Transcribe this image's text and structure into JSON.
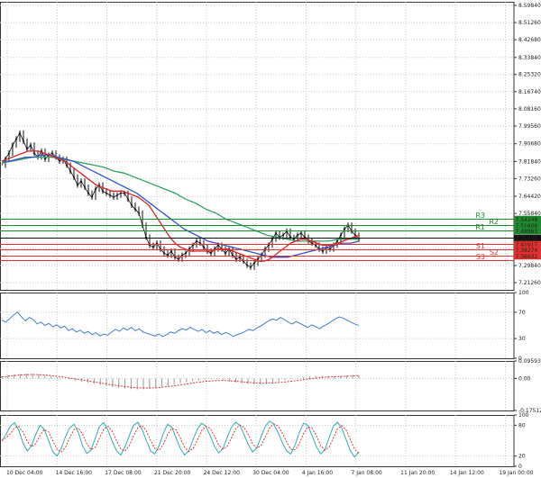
{
  "chart_data": {
    "type": "line",
    "price": {
      "yticks": [
        "8.59840",
        "8.51260",
        "8.42680",
        "8.33840",
        "8.25320",
        "8.16740",
        "8.08160",
        "7.99560",
        "7.90680",
        "7.81840",
        "7.73260",
        "7.64420",
        "7.55840",
        "7.47260",
        "7.38420",
        "7.29840",
        "7.21260"
      ],
      "ylim": [
        7.2126,
        8.5984
      ],
      "close": [
        7.8,
        7.83,
        7.86,
        7.9,
        7.93,
        7.96,
        7.92,
        7.88,
        7.9,
        7.86,
        7.84,
        7.87,
        7.83,
        7.85,
        7.86,
        7.84,
        7.82,
        7.83,
        7.8,
        7.77,
        7.74,
        7.7,
        7.72,
        7.69,
        7.66,
        7.64,
        7.68,
        7.7,
        7.67,
        7.66,
        7.65,
        7.64,
        7.65,
        7.66,
        7.66,
        7.63,
        7.6,
        7.58,
        7.56,
        7.5,
        7.44,
        7.4,
        7.39,
        7.41,
        7.38,
        7.36,
        7.35,
        7.37,
        7.34,
        7.33,
        7.35,
        7.36,
        7.38,
        7.4,
        7.42,
        7.41,
        7.39,
        7.37,
        7.36,
        7.38,
        7.4,
        7.38,
        7.36,
        7.38,
        7.35,
        7.33,
        7.34,
        7.32,
        7.3,
        7.29,
        7.31,
        7.33,
        7.35,
        7.38,
        7.4,
        7.43,
        7.46,
        7.44,
        7.45,
        7.47,
        7.44,
        7.43,
        7.45,
        7.46,
        7.44,
        7.42,
        7.41,
        7.4,
        7.38,
        7.37,
        7.39,
        7.38,
        7.4,
        7.42,
        7.45,
        7.48,
        7.5,
        7.47,
        7.45,
        7.43
      ],
      "ma_fast": [
        7.82,
        7.83,
        7.84,
        7.85,
        7.86,
        7.87,
        7.87,
        7.87,
        7.86,
        7.85,
        7.84,
        7.83,
        7.82,
        7.8,
        7.78,
        7.76,
        7.74,
        7.72,
        7.7,
        7.69,
        7.68,
        7.67,
        7.67,
        7.67,
        7.66,
        7.65,
        7.64,
        7.62,
        7.6,
        7.56,
        7.52,
        7.48,
        7.44,
        7.41,
        7.39,
        7.38,
        7.37,
        7.37,
        7.37,
        7.37,
        7.37,
        7.38,
        7.38,
        7.38,
        7.37,
        7.36,
        7.35,
        7.34,
        7.33,
        7.32,
        7.32,
        7.33,
        7.35,
        7.37,
        7.39,
        7.41,
        7.42,
        7.43,
        7.43,
        7.42,
        7.41,
        7.4,
        7.4,
        7.4,
        7.41,
        7.42,
        7.43,
        7.44,
        7.45
      ],
      "ma_mid": [
        7.82,
        7.82,
        7.83,
        7.84,
        7.84,
        7.85,
        7.85,
        7.84,
        7.83,
        7.82,
        7.8,
        7.78,
        7.76,
        7.74,
        7.72,
        7.7,
        7.68,
        7.66,
        7.63,
        7.6,
        7.57,
        7.54,
        7.51,
        7.48,
        7.46,
        7.44,
        7.42,
        7.41,
        7.4,
        7.39,
        7.38,
        7.37,
        7.36,
        7.35,
        7.34,
        7.34,
        7.34,
        7.35,
        7.36,
        7.37,
        7.38,
        7.39,
        7.4,
        7.41,
        7.41,
        7.42
      ],
      "ma_slow": [
        7.81,
        7.82,
        7.83,
        7.84,
        7.84,
        7.84,
        7.83,
        7.82,
        7.81,
        7.8,
        7.79,
        7.77,
        7.76,
        7.74,
        7.72,
        7.7,
        7.68,
        7.66,
        7.63,
        7.61,
        7.58,
        7.56,
        7.53,
        7.51,
        7.49,
        7.47,
        7.45,
        7.44,
        7.43,
        7.42,
        7.42,
        7.42,
        7.42,
        7.43,
        7.43,
        7.43
      ],
      "levels": [
        {
          "name": "R3",
          "value": "7.54248",
          "color": "#1e8c2e"
        },
        {
          "name": "R2",
          "value": "7.51606",
          "color": "#1e8c2e"
        },
        {
          "name": "R1",
          "value": "7.48963",
          "color": "#1e8c2e"
        },
        {
          "name": "",
          "value": "7.45240",
          "color": "#111111"
        },
        {
          "name": "",
          "value": "7.41917",
          "color": "#e03030"
        },
        {
          "name": "S1",
          "value": "7.39274",
          "color": "#e03030"
        },
        {
          "name": "S2",
          "value": "7.36632",
          "color": "#e03030"
        },
        {
          "name": "S3",
          "value": "",
          "color": "#e03030"
        }
      ]
    },
    "rsi": {
      "yticks": [
        "100",
        "70",
        "30",
        "0"
      ],
      "ylim": [
        0,
        100
      ],
      "values": [
        58,
        55,
        60,
        66,
        70,
        63,
        57,
        62,
        59,
        52,
        55,
        50,
        53,
        48,
        51,
        46,
        49,
        42,
        45,
        40,
        43,
        38,
        41,
        36,
        39,
        34,
        37,
        35,
        40,
        44,
        41,
        46,
        43,
        47,
        42,
        45,
        40,
        38,
        36,
        34,
        37,
        33,
        36,
        40,
        38,
        42,
        45,
        43,
        47,
        44,
        41,
        44,
        39,
        42,
        38,
        41,
        36,
        39,
        37,
        33,
        36,
        38,
        41,
        44,
        42,
        46,
        49,
        53,
        57,
        60,
        58,
        62,
        59,
        55,
        52,
        56,
        53,
        50,
        47,
        51,
        48,
        45,
        49,
        52,
        56,
        60,
        63,
        61,
        58,
        55,
        52,
        50
      ]
    },
    "macd": {
      "yticks": [
        "0.095931",
        "0.00",
        "-0.175129"
      ],
      "ylim": [
        -0.175129,
        0.095931
      ],
      "hist": [
        0.012,
        0.018,
        0.022,
        0.025,
        0.027,
        0.026,
        0.022,
        0.018,
        0.012,
        0.006,
        0.0,
        -0.006,
        -0.012,
        -0.018,
        -0.024,
        -0.03,
        -0.036,
        -0.042,
        -0.048,
        -0.052,
        -0.055,
        -0.058,
        -0.06,
        -0.058,
        -0.055,
        -0.05,
        -0.044,
        -0.038,
        -0.032,
        -0.026,
        -0.02,
        -0.014,
        -0.01,
        -0.006,
        -0.004,
        -0.006,
        -0.01,
        -0.016,
        -0.022,
        -0.028,
        -0.032,
        -0.034,
        -0.032,
        -0.028,
        -0.022,
        -0.016,
        -0.01,
        -0.004,
        0.002,
        0.008,
        0.012,
        0.014,
        0.014,
        0.012,
        0.01,
        0.012,
        0.016,
        0.02,
        0.018
      ],
      "signal": [
        0.008,
        0.012,
        0.016,
        0.019,
        0.021,
        0.022,
        0.021,
        0.019,
        0.016,
        0.012,
        0.008,
        0.003,
        -0.002,
        -0.008,
        -0.013,
        -0.019,
        -0.024,
        -0.03,
        -0.035,
        -0.04,
        -0.044,
        -0.048,
        -0.051,
        -0.052,
        -0.052,
        -0.051,
        -0.048,
        -0.044,
        -0.04,
        -0.035,
        -0.03,
        -0.025,
        -0.02,
        -0.016,
        -0.013,
        -0.011,
        -0.011,
        -0.012,
        -0.015,
        -0.018,
        -0.021,
        -0.024,
        -0.026,
        -0.026,
        -0.025,
        -0.022,
        -0.019,
        -0.015,
        -0.011,
        -0.006,
        -0.002,
        0.002,
        0.006,
        0.008,
        0.01,
        0.011,
        0.012,
        0.014,
        0.016
      ]
    },
    "stoch": {
      "yticks": [
        "100",
        "80",
        "20",
        "0"
      ],
      "ylim": [
        0,
        100
      ],
      "main": [
        50,
        62,
        78,
        85,
        70,
        45,
        30,
        40,
        62,
        80,
        72,
        50,
        28,
        20,
        35,
        58,
        75,
        82,
        66,
        40,
        25,
        32,
        55,
        78,
        85,
        70,
        48,
        30,
        22,
        38,
        60,
        80,
        86,
        72,
        50,
        30,
        24,
        40,
        64,
        82,
        76,
        55,
        35,
        22,
        30,
        52,
        72,
        84,
        78,
        60,
        40,
        26,
        34,
        56,
        76,
        86,
        80,
        62,
        42,
        28,
        36,
        58,
        78,
        88,
        82,
        66,
        46,
        30,
        24,
        42,
        66,
        84,
        80,
        60,
        38,
        24,
        32,
        56,
        78,
        86,
        74,
        52,
        30,
        18,
        28
      ]
    },
    "xticks": [
      "10 Dec 04:00",
      "14 Dec 16:00",
      "17 Dec 08:00",
      "21 Dec 20:00",
      "24 Dec 12:00",
      "30 Dec 04:00",
      "4 Jan 16:00",
      "7 Jan 08:00",
      "11 Jan 20:00",
      "14 Jan 12:00",
      "19 Jan 00:00"
    ],
    "colors": {
      "price": "#111111",
      "ma_fast": "#e02020",
      "ma_mid": "#3050d0",
      "ma_slow": "#30a060",
      "osc": "#3070d0",
      "signal": "#e02020",
      "stoch": "#1aa5b5"
    }
  }
}
